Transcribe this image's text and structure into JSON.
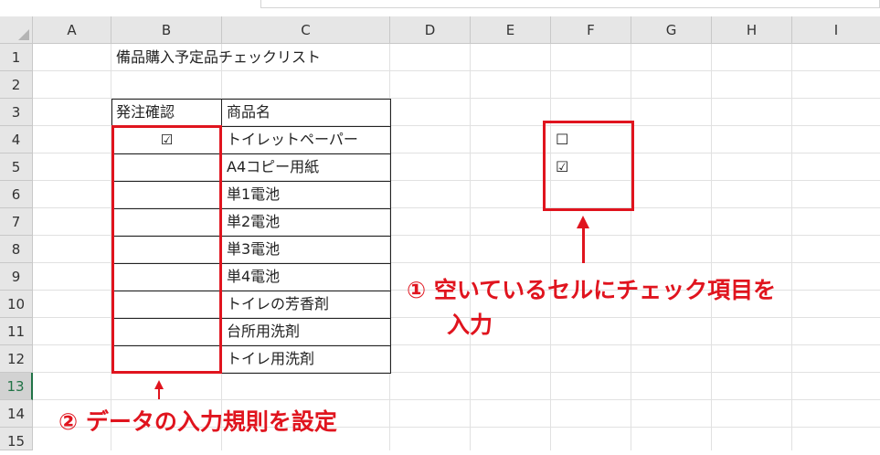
{
  "columns": [
    "A",
    "B",
    "C",
    "D",
    "E",
    "F",
    "G",
    "H",
    "I"
  ],
  "rows": [
    "1",
    "2",
    "3",
    "4",
    "5",
    "6",
    "7",
    "8",
    "9",
    "10",
    "11",
    "12",
    "13",
    "14",
    "15"
  ],
  "selected_row": "13",
  "title": "備品購入予定品チェックリスト",
  "table": {
    "header_check": "発注確認",
    "header_name": "商品名",
    "items": [
      "トイレットペーパー",
      "A4コピー用紙",
      "単1電池",
      "単2電池",
      "単3電池",
      "単4電池",
      "トイレの芳香剤",
      "台所用洗剤",
      "トイレ用洗剤"
    ],
    "check_b4": "☑"
  },
  "side_list": {
    "f4": "☐",
    "f5": "☑"
  },
  "annotations": {
    "note1_line1": "① 空いているセルにチェック項目を",
    "note1_line2": "入力",
    "note2": "② データの入力規則を設定"
  },
  "colors": {
    "accent_red": "#e0141e",
    "selected_row_green": "#217346"
  }
}
